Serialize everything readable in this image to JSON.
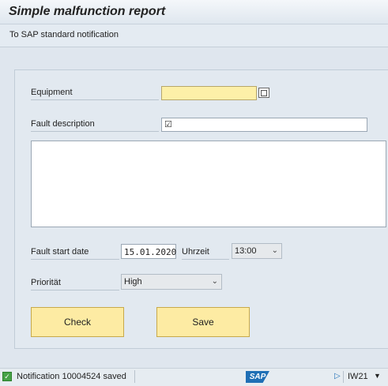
{
  "window": {
    "title": "Simple malfunction report"
  },
  "toolbar": {
    "link": "To SAP standard notification"
  },
  "form": {
    "equipment_label": "Equipment",
    "equipment_value": "",
    "fault_desc_label": "Fault description",
    "fault_desc_value": "",
    "long_text": "",
    "fault_start_label": "Fault start date",
    "fault_start_value": "15.01.2020",
    "uhrzeit_label": "Uhrzeit",
    "uhrzeit_value": "13:00",
    "prioritaet_label": "Priorität",
    "prioritaet_value": "High",
    "check_button": "Check",
    "save_button": "Save"
  },
  "status": {
    "message": "Notification 10004524 saved",
    "logo": "SAP",
    "tcode": "IW21",
    "icons": {
      "ok": "check-icon",
      "play": "play-icon",
      "dropdown": "chevron-down-icon"
    },
    "colors": {
      "ok": "#46a247",
      "button": "#fdeba3",
      "required": "#fdf0a8"
    }
  }
}
